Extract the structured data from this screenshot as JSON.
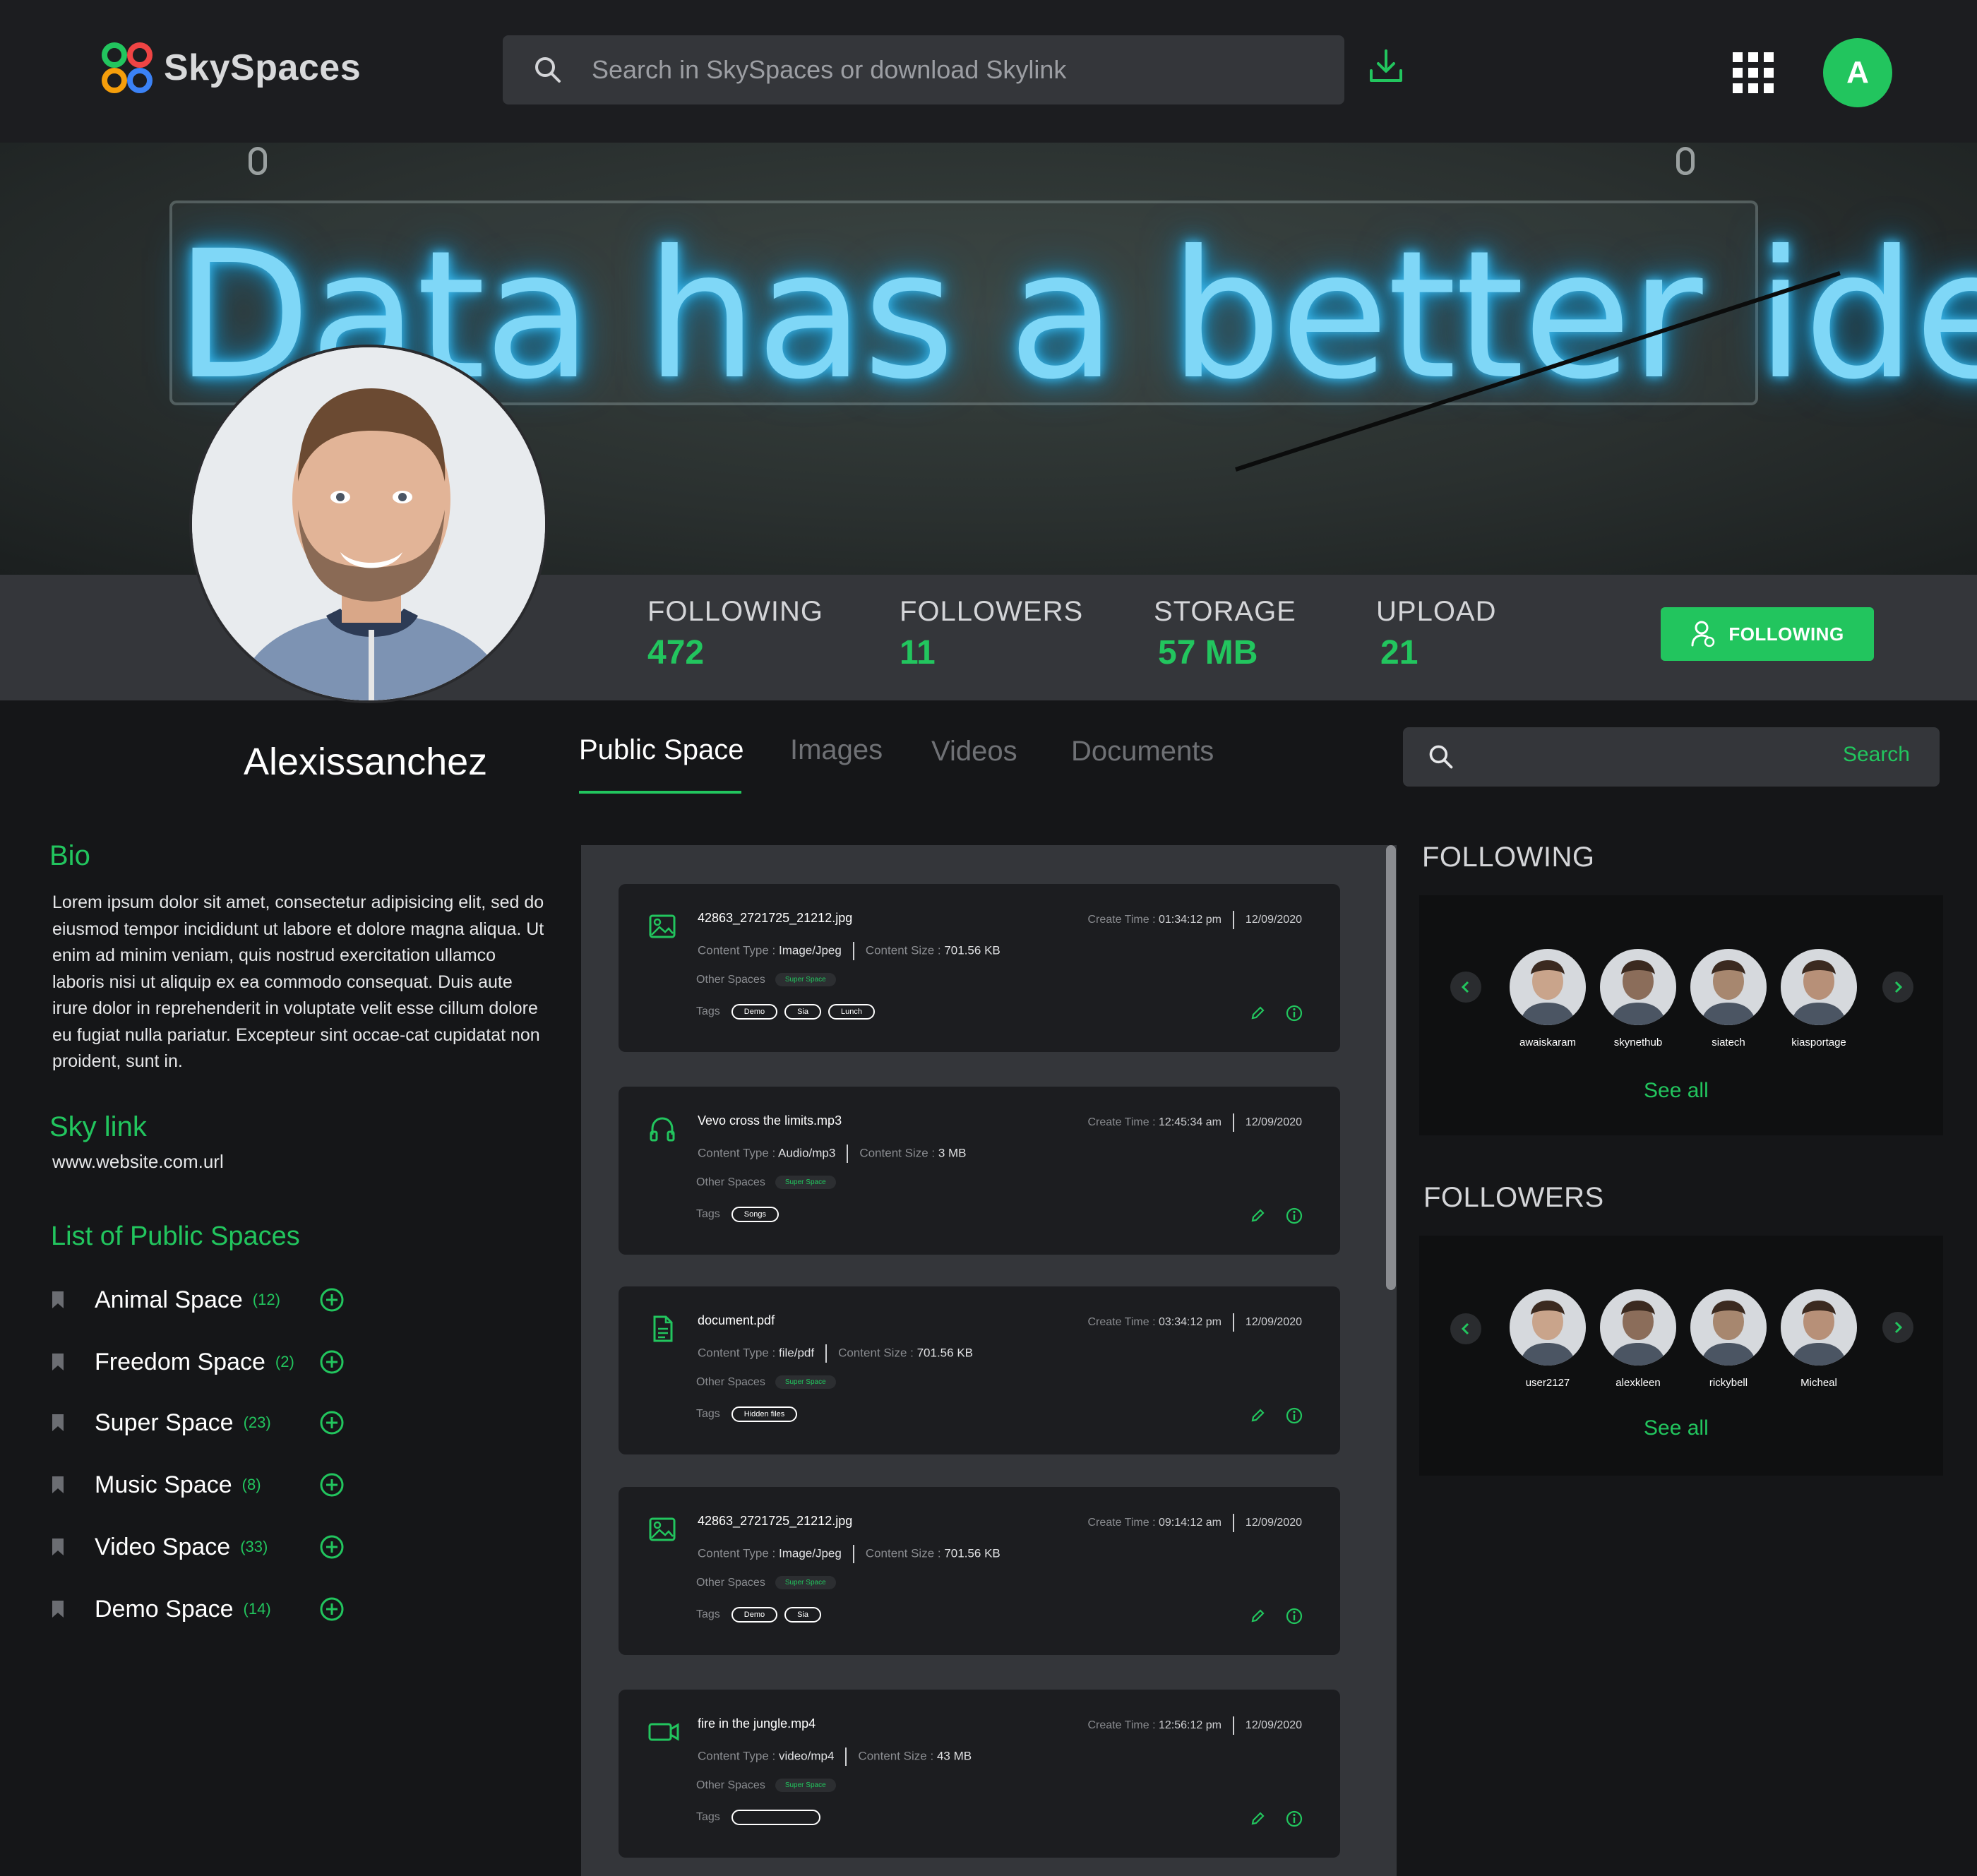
{
  "header": {
    "brand": "SkySpaces",
    "search_placeholder": "Search in SkySpaces or download Skylink",
    "user_initial": "A"
  },
  "banner": {
    "text": "Data has a better idea"
  },
  "stats": [
    {
      "label": "FOLLOWING",
      "value": "472"
    },
    {
      "label": "FOLLOWERS",
      "value": "11"
    },
    {
      "label": "STORAGE",
      "value": "57 MB"
    },
    {
      "label": "UPLOAD",
      "value": "21"
    }
  ],
  "follow_button": "FOLLOWING",
  "profile": {
    "username": "Alexissanchez"
  },
  "tabs": [
    {
      "label": "Public Space",
      "active": true
    },
    {
      "label": "Images",
      "active": false
    },
    {
      "label": "Videos",
      "active": false
    },
    {
      "label": "Documents",
      "active": false
    }
  ],
  "content_search": {
    "button": "Search"
  },
  "bio": {
    "heading": "Bio",
    "text": "Lorem ipsum dolor sit amet, consectetur adipisicing elit, sed do eiusmod tempor incididunt ut labore et dolore magna aliqua. Ut enim ad minim veniam, quis nostrud exercitation ullamco laboris nisi ut aliquip ex ea commodo consequat. Duis aute irure dolor in reprehenderit in voluptate velit esse cillum dolore eu fugiat nulla pariatur. Excepteur sint occae-cat cupidatat non proident, sunt in."
  },
  "skylink": {
    "heading": "Sky link",
    "url": "www.website.com.url"
  },
  "public_spaces": {
    "heading": "List of Public Spaces",
    "items": [
      {
        "name": "Animal Space",
        "count": "(12)"
      },
      {
        "name": "Freedom Space",
        "count": "(2)"
      },
      {
        "name": "Super Space",
        "count": "(23)"
      },
      {
        "name": "Music Space",
        "count": "(8)"
      },
      {
        "name": "Video Space",
        "count": "(33)"
      },
      {
        "name": "Demo Space",
        "count": "(14)"
      }
    ]
  },
  "files": [
    {
      "icon": "image-icon",
      "name": "42863_2721725_21212.jpg",
      "time": "01:34:12 pm",
      "date": "12/09/2020",
      "type": "Image/Jpeg",
      "size": "701.56 KB",
      "other_space": "Super Space",
      "tags": [
        "Demo",
        "Sia",
        "Lunch"
      ]
    },
    {
      "icon": "headphones-icon",
      "name": "Vevo cross the limits.mp3",
      "time": "12:45:34 am",
      "date": "12/09/2020",
      "type": "Audio/mp3",
      "size": "3 MB",
      "other_space": "Super Space",
      "tags": [
        "Songs"
      ]
    },
    {
      "icon": "document-icon",
      "name": "document.pdf",
      "time": "03:34:12 pm",
      "date": "12/09/2020",
      "type": "file/pdf",
      "size": "701.56 KB",
      "other_space": "Super Space",
      "tags": [
        "Hidden files"
      ]
    },
    {
      "icon": "image-icon",
      "name": "42863_2721725_21212.jpg",
      "time": "09:14:12 am",
      "date": "12/09/2020",
      "type": "Image/Jpeg",
      "size": "701.56 KB",
      "other_space": "Super Space",
      "tags": [
        "Demo",
        "Sia"
      ]
    },
    {
      "icon": "video-icon",
      "name": "fire in the jungle.mp4",
      "time": "12:56:12 pm",
      "date": "12/09/2020",
      "type": "video/mp4",
      "size": "43 MB",
      "other_space": "Super Space",
      "tags": [
        ""
      ]
    }
  ],
  "file_labels": {
    "create_time": "Create Time : ",
    "content_type": "Content Type : ",
    "content_size": "Content Size : ",
    "other_spaces": "Other Spaces",
    "tags": "Tags"
  },
  "following_panel": {
    "title": "FOLLOWING",
    "people": [
      "awaiskaram",
      "skynethub",
      "siatech",
      "kiasportage"
    ],
    "see_all": "See all"
  },
  "followers_panel": {
    "title": "FOLLOWERS",
    "people": [
      "user2127",
      "alexkleen",
      "rickybell",
      "Micheal"
    ],
    "see_all": "See all"
  },
  "colors": {
    "accent": "#22c55e",
    "bg": "#151618",
    "header": "#1c1d20",
    "panel": "#34363a"
  }
}
